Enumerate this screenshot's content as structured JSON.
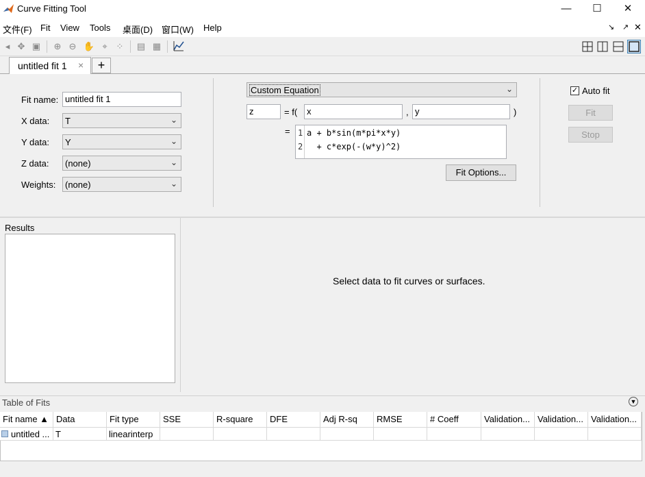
{
  "window": {
    "title": "Curve Fitting Tool",
    "minimize": "—",
    "maximize": "☐",
    "close": "✕"
  },
  "menu": [
    "文件(F)",
    "Fit",
    "View",
    "Tools",
    "桌面(D)",
    "窗口(W)",
    "Help"
  ],
  "tabs": {
    "active_label": "untitled fit 1",
    "close": "×",
    "add": "+"
  },
  "fit": {
    "name_label": "Fit name:",
    "name_value": "untitled fit 1",
    "xdata_label": "X data:",
    "xdata_value": "T",
    "ydata_label": "Y data:",
    "ydata_value": "Y",
    "zdata_label": "Z data:",
    "zdata_value": "(none)",
    "weights_label": "Weights:",
    "weights_value": "(none)",
    "equation_type": "Custom Equation",
    "dep_var": "z",
    "equals_f": "= f(",
    "indep_var1": "x",
    "comma": ",",
    "indep_var2": "y",
    "close_paren": ")",
    "equals": "=",
    "equation_lines": [
      "a + b*sin(m*pi*x*y)",
      "  + c*exp(-(w*y)^2)"
    ],
    "line_numbers": [
      "1",
      "2"
    ],
    "fit_options_label": "Fit Options...",
    "auto_fit_label": "Auto fit",
    "auto_fit_checked": true,
    "fit_button": "Fit",
    "stop_button": "Stop"
  },
  "results": {
    "label": "Results"
  },
  "plot": {
    "message": "Select data to fit curves or surfaces."
  },
  "table_of_fits": {
    "title": "Table of Fits",
    "columns": [
      "Fit name ▲",
      "Data",
      "Fit type",
      "SSE",
      "R-square",
      "DFE",
      "Adj R-sq",
      "RMSE",
      "# Coeff",
      "Validation...",
      "Validation...",
      "Validation..."
    ],
    "rows": [
      [
        "untitled ...",
        "T",
        "linearinterp",
        "",
        "",
        "",
        "",
        "",
        "",
        "",
        "",
        ""
      ]
    ]
  }
}
